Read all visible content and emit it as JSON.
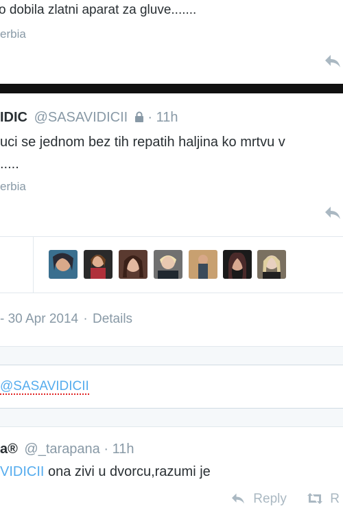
{
  "tweet1": {
    "text": "o dobila zlatni  aparat za gluve.......",
    "location": "erbia"
  },
  "tweet2": {
    "name": "IDIC",
    "handle": "@SASAVIDICII",
    "time": "11h",
    "text_line1": "uci se jednom bez tih repatih haljina ko mrtvu v",
    "text_line2": ".....",
    "location": "erbia"
  },
  "favorites": {
    "avatars": [
      {
        "name": "favoriter-1",
        "color": "#3a6f8f"
      },
      {
        "name": "favoriter-2",
        "color": "#b0303a"
      },
      {
        "name": "favoriter-3",
        "color": "#5a3a30"
      },
      {
        "name": "favoriter-4",
        "color": "#404a5a"
      },
      {
        "name": "favoriter-5",
        "color": "#6a8a9a"
      },
      {
        "name": "favoriter-6",
        "color": "#4a2a2a"
      },
      {
        "name": "favoriter-7",
        "color": "#7a7060"
      }
    ]
  },
  "meta": {
    "date": "- 30 Apr 2014",
    "separator": "·",
    "details": "Details"
  },
  "reply_box": {
    "mention": "@SASAVIDICII"
  },
  "reply_tweet": {
    "name": "a®",
    "handle": "@_tarapana",
    "time": "11h",
    "mention": "VIDICII",
    "text": " ona zivi u dvorcu,razumi je",
    "actions": {
      "reply": "Reply",
      "retweet": "R"
    }
  },
  "icons": {
    "reply": "reply-icon",
    "lock": "lock-icon",
    "retweet": "retweet-icon"
  }
}
